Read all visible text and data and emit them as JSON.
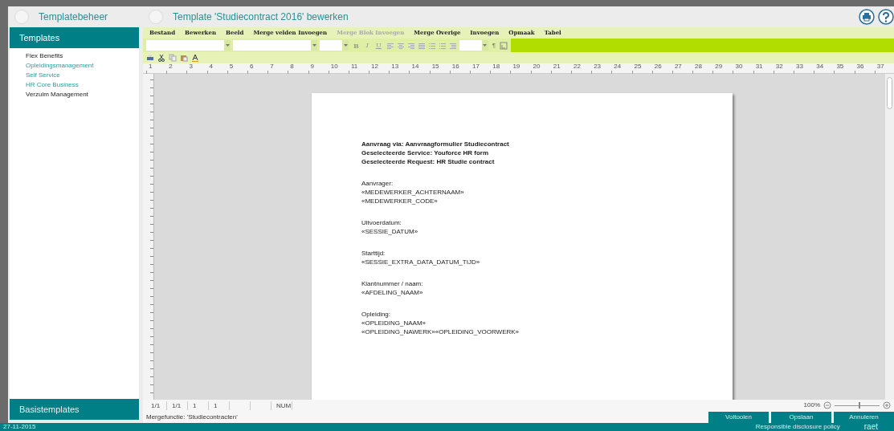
{
  "header": {
    "left_title": "Templatebeheer",
    "title": "Template 'Studiecontract 2016' bewerken"
  },
  "sidebar": {
    "section": "Templates",
    "items": [
      {
        "label": "Flex Benefits",
        "highlighted": false
      },
      {
        "label": "Opleidingsmanagement",
        "highlighted": true
      },
      {
        "label": "Self Service",
        "highlighted": true
      },
      {
        "label": "HR Core Business",
        "highlighted": true
      },
      {
        "label": "Verzuim Management",
        "highlighted": false
      }
    ],
    "footer_section": "Basistemplates"
  },
  "menu": [
    {
      "label": "Bestand",
      "disabled": false
    },
    {
      "label": "Bewerken",
      "disabled": false
    },
    {
      "label": "Beeld",
      "disabled": false
    },
    {
      "label": "Merge velden Invoegen",
      "disabled": false
    },
    {
      "label": "Merge Blok Invoegen",
      "disabled": true
    },
    {
      "label": "Merge Overige",
      "disabled": false
    },
    {
      "label": "Invoegen",
      "disabled": false
    },
    {
      "label": "Opmaak",
      "disabled": false
    },
    {
      "label": "Tabel",
      "disabled": false
    }
  ],
  "format_buttons": [
    "B",
    "I",
    "U"
  ],
  "pilcrow": "¶",
  "ruler": [
    "1",
    "2",
    "3",
    "4",
    "5",
    "6",
    "7",
    "8",
    "9",
    "10",
    "11",
    "12",
    "13",
    "14",
    "15",
    "16",
    "17",
    "18",
    "19",
    "20",
    "21",
    "22",
    "23",
    "24",
    "25",
    "26",
    "27",
    "28",
    "29",
    "30",
    "31",
    "32",
    "33",
    "34",
    "35",
    "36",
    "37"
  ],
  "document": [
    {
      "bold": true,
      "lines": [
        "Aanvraag via: Aanvraagformulier Studiecontract",
        "Geselecteerde Service: Youforce HR form",
        "Geselecteerde Request: HR Studie contract"
      ]
    },
    {
      "bold": false,
      "lines": [
        "Aanvrager:",
        "«MEDEWERKER_ACHTERNAAM»",
        "«MEDEWERKER_CODE»"
      ]
    },
    {
      "bold": false,
      "lines": [
        "Uitvoerdatum:",
        "«SESSIE_DATUM»"
      ]
    },
    {
      "bold": false,
      "lines": [
        "Starttijd:",
        "«SESSIE_EXTRA_DATA_DATUM_TIJD»"
      ]
    },
    {
      "bold": false,
      "lines": [
        "Klantnummer / naam:",
        "«AFDELING_NAAM»"
      ]
    },
    {
      "bold": false,
      "lines": [
        "Opleiding:",
        "«OPLEIDING_NAAM»",
        "«OPLEIDING_NAWERK»«OPLEIDING_VOORWERK»"
      ]
    }
  ],
  "status": {
    "cells": [
      "1/1",
      "1/1",
      "1",
      "1",
      "NUM"
    ],
    "zoom": "100%",
    "slider": {
      "level": 0.55
    },
    "merge": "Mergefunctie: 'Studiecontracten'"
  },
  "actions": [
    "Voltooien",
    "Opslaan",
    "Annuleren"
  ],
  "footer": {
    "date": "27-11-2015",
    "link": "Responsible disclosure policy",
    "logo": "raet"
  }
}
